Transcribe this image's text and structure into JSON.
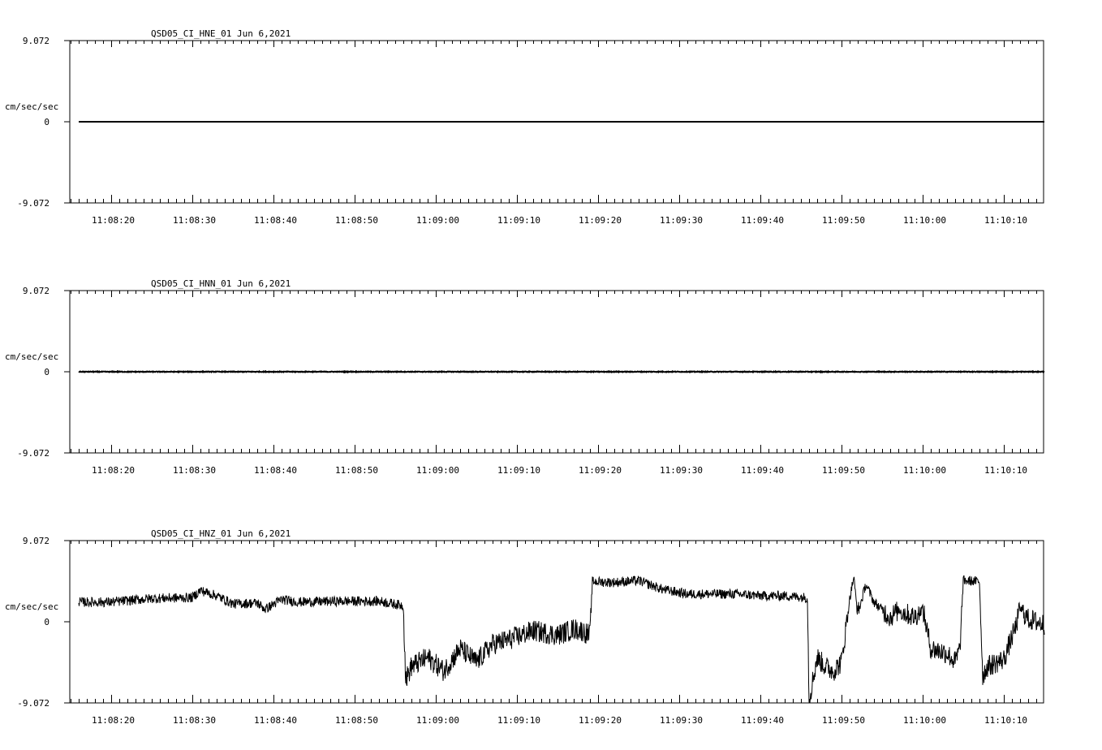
{
  "chart_data": [
    {
      "type": "line",
      "title": "QSD05_CI_HNE_01  Jun 6,2021",
      "ylabel": "cm/sec/sec",
      "ylim": [
        -9.072,
        9.072
      ],
      "y_tick_labels": [
        "9.072",
        "0",
        "-9.072"
      ],
      "x_tick_labels": [
        "11:08:20",
        "11:08:30",
        "11:08:40",
        "11:08:50",
        "11:09:00",
        "11:09:10",
        "11:09:20",
        "11:09:30",
        "11:09:40",
        "11:09:50",
        "11:10:00",
        "11:10:10"
      ],
      "series": [
        {
          "x": [
            "11:08:16",
            "11:10:15"
          ],
          "values": [
            0,
            0
          ]
        }
      ]
    },
    {
      "type": "line",
      "title": "QSD05_CI_HNN_01  Jun 6,2021",
      "ylabel": "cm/sec/sec",
      "ylim": [
        -9.072,
        9.072
      ],
      "y_tick_labels": [
        "9.072",
        "0",
        "-9.072"
      ],
      "x_tick_labels": [
        "11:08:20",
        "11:08:30",
        "11:08:40",
        "11:08:50",
        "11:09:00",
        "11:09:10",
        "11:09:20",
        "11:09:30",
        "11:09:40",
        "11:09:50",
        "11:10:00",
        "11:10:10"
      ],
      "series": [
        {
          "x": [
            "11:08:16",
            "11:10:15"
          ],
          "values": [
            0,
            0
          ]
        }
      ]
    },
    {
      "type": "line",
      "title": "QSD05_CI_HNZ_01  Jun 6,2021",
      "ylabel": "cm/sec/sec",
      "ylim": [
        -9.072,
        9.072
      ],
      "y_tick_labels": [
        "9.072",
        "0",
        "-9.072"
      ],
      "x_tick_labels": [
        "11:08:20",
        "11:08:30",
        "11:08:40",
        "11:08:50",
        "11:09:00",
        "11:09:10",
        "11:09:20",
        "11:09:30",
        "11:09:40",
        "11:09:50",
        "11:10:00",
        "11:10:10"
      ],
      "series": [
        {
          "x": [
            "11:08:16",
            "11:08:20",
            "11:08:25",
            "11:08:30",
            "11:08:31",
            "11:08:33",
            "11:08:35",
            "11:08:38",
            "11:08:39",
            "11:08:41",
            "11:08:43",
            "11:08:48",
            "11:08:53",
            "11:08:56",
            "11:08:56.3",
            "11:08:57",
            "11:08:59",
            "11:09:01",
            "11:09:03",
            "11:09:05",
            "11:09:07",
            "11:09:09",
            "11:09:12",
            "11:09:15",
            "11:09:17",
            "11:09:18",
            "11:09:19",
            "11:09:19.3",
            "11:09:22",
            "11:09:25",
            "11:09:28",
            "11:09:31",
            "11:09:34",
            "11:09:37",
            "11:09:40",
            "11:09:43",
            "11:09:45.8",
            "11:09:46",
            "11:09:47",
            "11:09:48",
            "11:09:49",
            "11:09:50",
            "11:09:51",
            "11:09:51.5",
            "11:09:52",
            "11:09:53",
            "11:09:54",
            "11:09:56",
            "11:09:57",
            "11:09:59",
            "11:10:00",
            "11:10:01",
            "11:10:03",
            "11:10:04",
            "11:10:04.6",
            "11:10:05",
            "11:10:07",
            "11:10:07.4",
            "11:10:08",
            "11:10:10",
            "11:10:11.5",
            "11:10:12",
            "11:10:13",
            "11:10:15"
          ],
          "values": [
            2.2,
            2.2,
            2.6,
            2.7,
            3.5,
            2.9,
            2.0,
            2.1,
            1.4,
            2.5,
            2.2,
            2.3,
            2.3,
            1.8,
            -6.5,
            -5.0,
            -4.0,
            -5.5,
            -3.0,
            -4.5,
            -2.5,
            -2.0,
            -1.0,
            -1.5,
            -0.8,
            -1.0,
            -1.5,
            4.5,
            4.4,
            4.6,
            3.6,
            3.1,
            3.1,
            3.1,
            2.9,
            2.9,
            2.7,
            -8.7,
            -4.0,
            -5.0,
            -5.5,
            -4.5,
            2.5,
            5.0,
            0.8,
            4.2,
            2.2,
            0.5,
            1.3,
            0.5,
            1.5,
            -3.0,
            -3.5,
            -4.5,
            -3.0,
            4.6,
            4.5,
            -6.0,
            -5.0,
            -4.2,
            -0.5,
            1.5,
            0.3,
            -0.3
          ]
        }
      ]
    }
  ]
}
